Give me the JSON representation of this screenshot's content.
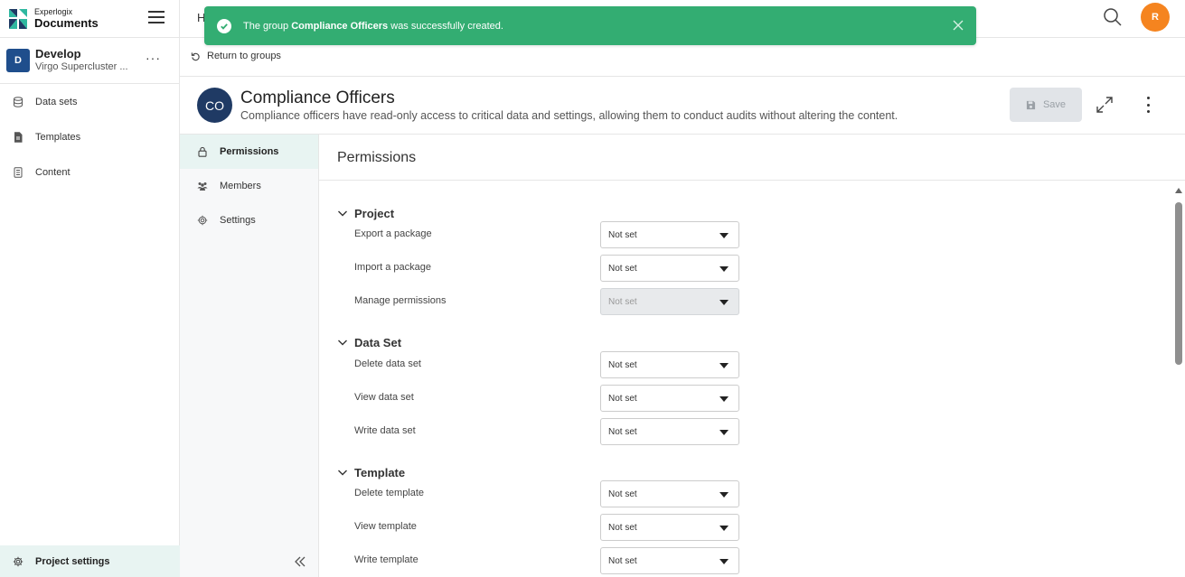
{
  "brand": {
    "line1": "Experlogix",
    "line2": "Documents"
  },
  "project": {
    "initial": "D",
    "name": "Develop",
    "subtitle": "Virgo Supercluster ...",
    "more": "···"
  },
  "nav": [
    {
      "label": "Data sets",
      "icon": "database-icon"
    },
    {
      "label": "Templates",
      "icon": "document-icon"
    },
    {
      "label": "Content",
      "icon": "content-icon"
    }
  ],
  "project_settings": {
    "label": "Project settings",
    "icon": "gear-icon"
  },
  "topbar": {
    "breadcrumb_partial": "H",
    "user_initial": "R"
  },
  "colors": {
    "accent": "#33ad72",
    "user": "#f5841f",
    "group": "#1f3a64",
    "project": "#1f4e8c"
  },
  "toast": {
    "prefix": "The group ",
    "group_name": "Compliance Officers",
    "suffix": " was successfully created."
  },
  "return_link": "Return to groups",
  "group": {
    "initials": "CO",
    "title": "Compliance Officers",
    "description": "Compliance officers have read-only access to critical data and settings, allowing them to conduct audits without altering the content."
  },
  "save_label": "Save",
  "subnav": [
    {
      "label": "Permissions",
      "icon": "lock-icon"
    },
    {
      "label": "Members",
      "icon": "members-icon"
    },
    {
      "label": "Settings",
      "icon": "gear-icon"
    }
  ],
  "main_title": "Permissions",
  "sections": [
    {
      "title": "Project",
      "rows": [
        {
          "label": "Export a package",
          "value": "Not set"
        },
        {
          "label": "Import a package",
          "value": "Not set"
        },
        {
          "label": "Manage permissions",
          "value": "Not set"
        }
      ]
    },
    {
      "title": "Data Set",
      "rows": [
        {
          "label": "Delete data set",
          "value": "Not set"
        },
        {
          "label": "View data set",
          "value": "Not set"
        },
        {
          "label": "Write data set",
          "value": "Not set"
        }
      ]
    },
    {
      "title": "Template",
      "rows": [
        {
          "label": "Delete template",
          "value": "Not set"
        },
        {
          "label": "View template",
          "value": "Not set"
        },
        {
          "label": "Write template",
          "value": "Not set"
        }
      ]
    }
  ]
}
